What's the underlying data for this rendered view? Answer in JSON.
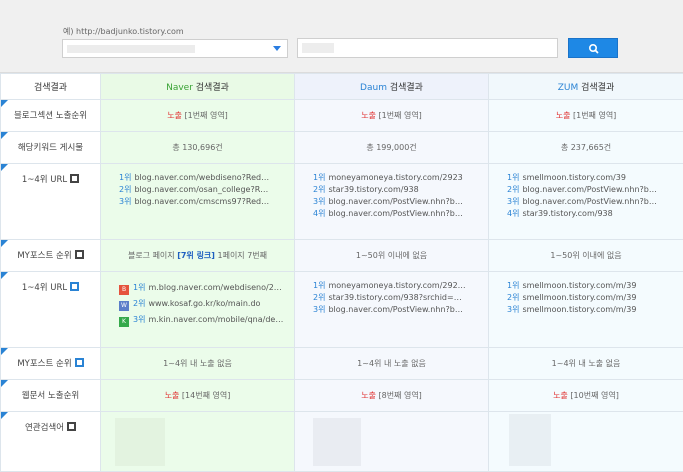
{
  "search": {
    "hint": "예) http://badjunko.tistory.com",
    "url_value": "",
    "keyword_value": ""
  },
  "header": {
    "label": "검색결과",
    "naver_brand": "Naver",
    "daum_brand": "Daum",
    "zum_brand": "ZUM",
    "suffix": " 검색결과"
  },
  "rows": {
    "blog_section": {
      "label": "블로그섹션 노출순위",
      "naver": {
        "status": "노출",
        "detail": " [1번째 영역]"
      },
      "daum": {
        "status": "노출",
        "detail": " [1번째 영역]"
      },
      "zum": {
        "status": "노출",
        "detail": " [1번째 영역]"
      }
    },
    "keyword_posts": {
      "label": "해당키워드 게시물",
      "naver": "총 130,696건",
      "daum": "총 199,000건",
      "zum": "총 237,665건"
    },
    "top_urls_blog": {
      "label": "1~4위 URL",
      "naver": [
        {
          "rank": "1위",
          "url": "blog.naver.com/webdiseno?Red…"
        },
        {
          "rank": "2위",
          "url": "blog.naver.com/osan_college?R…"
        },
        {
          "rank": "3위",
          "url": "blog.naver.com/cmscms97?Red…"
        }
      ],
      "daum": [
        {
          "rank": "1위",
          "url": "moneyamoneya.tistory.com/2923"
        },
        {
          "rank": "2위",
          "url": "star39.tistory.com/938"
        },
        {
          "rank": "3위",
          "url": "blog.naver.com/PostView.nhn?b…"
        },
        {
          "rank": "4위",
          "url": "blog.naver.com/PostView.nhn?b…"
        }
      ],
      "zum": [
        {
          "rank": "1위",
          "url": "smellmoon.tistory.com/39"
        },
        {
          "rank": "2위",
          "url": "blog.naver.com/PostView.nhn?b…"
        },
        {
          "rank": "3위",
          "url": "blog.naver.com/PostView.nhn?b…"
        },
        {
          "rank": "4위",
          "url": "star39.tistory.com/938"
        }
      ]
    },
    "my_post_blog": {
      "label": "MY포스트 순위",
      "naver_pre": "블로그 페이지 ",
      "naver_hl": "[7위 링크]",
      "naver_post": " 1페이지 7번째",
      "daum": "1~50위 이내에 없음",
      "zum": "1~50위 이내에 없음"
    },
    "top_urls_web": {
      "label": "1~4위 URL",
      "naver": [
        {
          "icon": "B",
          "rank": "1위",
          "url": "m.blog.naver.com/webdiseno/2…"
        },
        {
          "icon": "W",
          "rank": "2위",
          "url": "www.kosaf.go.kr/ko/main.do"
        },
        {
          "icon": "K",
          "rank": "3위",
          "url": "m.kin.naver.com/mobile/qna/de…"
        }
      ],
      "daum": [
        {
          "rank": "1위",
          "url": "moneyamoneya.tistory.com/292…"
        },
        {
          "rank": "2위",
          "url": "star39.tistory.com/938?srchid=…"
        },
        {
          "rank": "3위",
          "url": "blog.naver.com/PostView.nhn?b…"
        }
      ],
      "zum": [
        {
          "rank": "1위",
          "url": "smellmoon.tistory.com/m/39"
        },
        {
          "rank": "2위",
          "url": "smellmoon.tistory.com/m/39"
        },
        {
          "rank": "3위",
          "url": "smellmoon.tistory.com/m/39"
        }
      ]
    },
    "my_post_web": {
      "label": "MY포스트 순위",
      "naver": "1~4위 내 노출 없음",
      "daum": "1~4위 내 노출 없음",
      "zum": "1~4위 내 노출 없음"
    },
    "web_doc": {
      "label": "웹문서 노출순위",
      "naver": {
        "status": "노출",
        "detail": " [14번째 영역]"
      },
      "daum": {
        "status": "노출",
        "detail": " [8번째 영역]"
      },
      "zum": {
        "status": "노출",
        "detail": " [10번째 영역]"
      }
    },
    "related": {
      "label": "연관검색어"
    }
  },
  "colors": {
    "accent": "#1e88e5",
    "red": "#e03030",
    "naver_green": "#3aa335"
  }
}
